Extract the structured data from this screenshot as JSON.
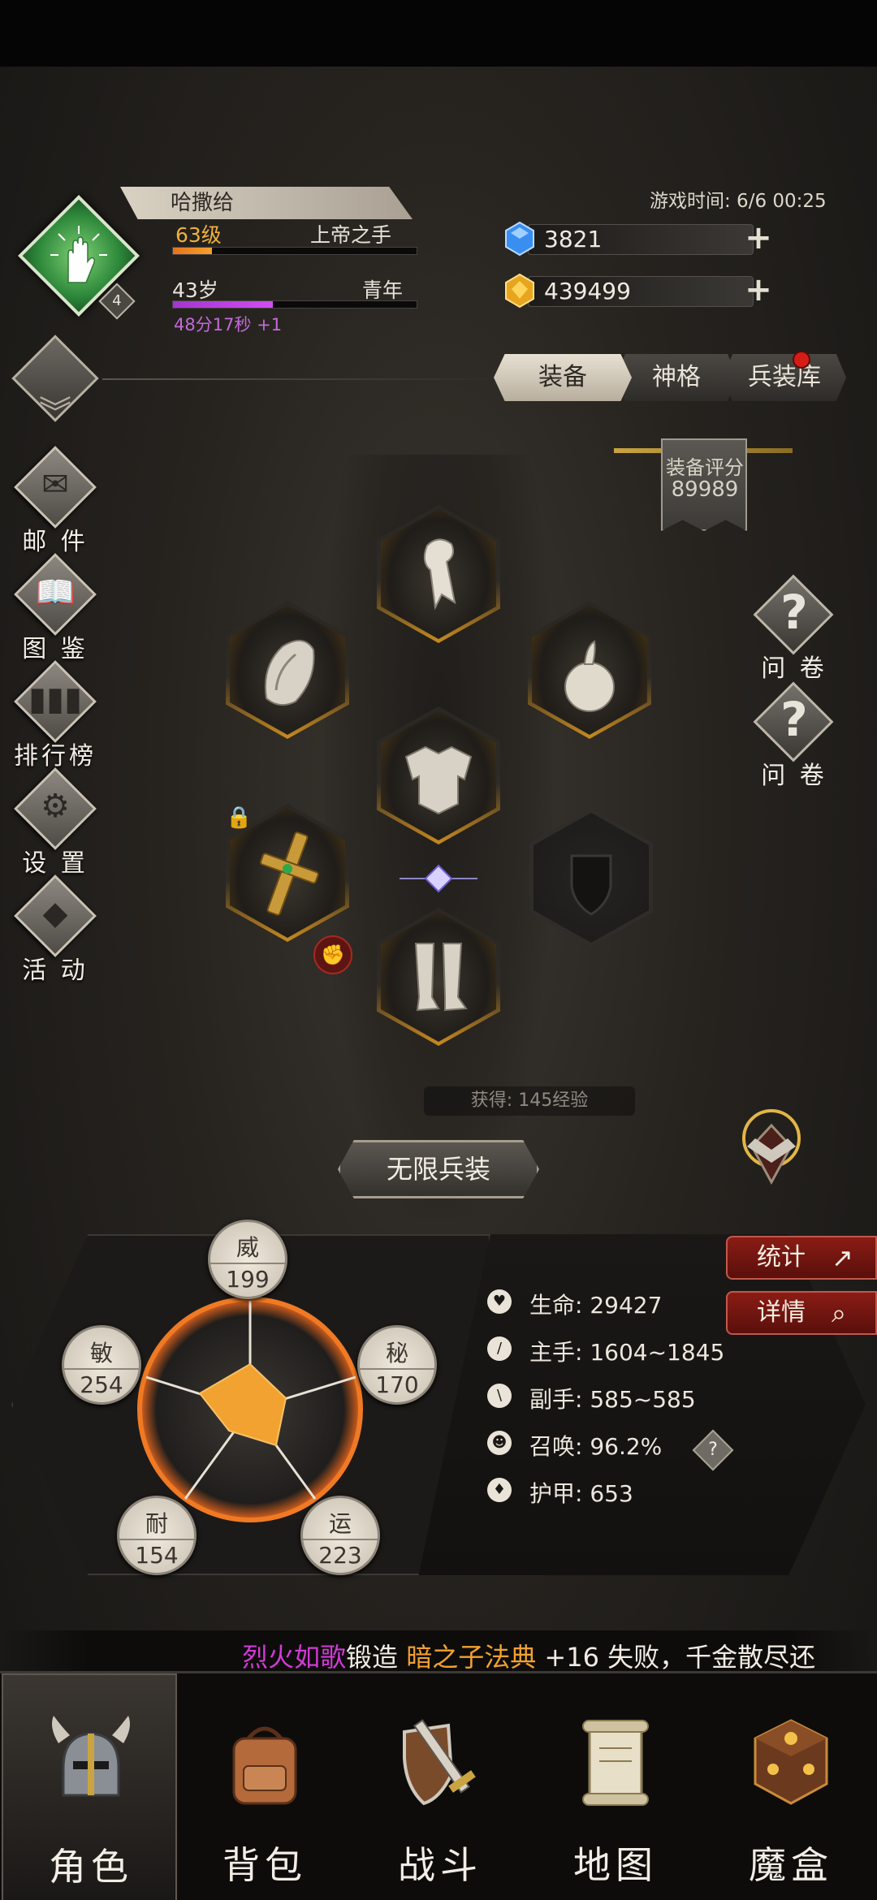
{
  "character": {
    "name": "哈撒给",
    "level": "63级",
    "title": "上帝之手",
    "xp_progress": 0.16,
    "age": "43岁",
    "age_stage": "青年",
    "age_progress": 0.41,
    "age_timer": "48分17秒 +1",
    "avatar_badge": "4"
  },
  "game_time": "游戏时间: 6/6 00:25",
  "currencies": {
    "gems": "3821",
    "gold": "439499"
  },
  "tabs": {
    "equip": "装备",
    "god": "神格",
    "armory": "兵装库"
  },
  "score": {
    "label": "装备评分",
    "value": "89989"
  },
  "left_menu": {
    "mail": "邮 件",
    "codex": "图 鉴",
    "ranking": "排行榜",
    "settings": "设 置",
    "events": "活 动"
  },
  "right_menu": {
    "survey1": "问 卷",
    "survey2": "问 卷",
    "q_glyph": "?"
  },
  "exp_gain": "获得: 145经验",
  "infinite_button": "无限兵装",
  "attributes": {
    "wei": {
      "name": "威",
      "value": "199"
    },
    "mi": {
      "name": "秘",
      "value": "170"
    },
    "yun": {
      "name": "运",
      "value": "223"
    },
    "nai": {
      "name": "耐",
      "value": "154"
    },
    "min": {
      "name": "敏",
      "value": "254"
    }
  },
  "side_buttons": {
    "stats": "统计",
    "details": "详情"
  },
  "stats": {
    "hp": "生命: 29427",
    "main": "主手: 1604~1845",
    "off": "副手: 585~585",
    "summon": "召唤: 96.2%",
    "armor": "护甲: 653"
  },
  "ticker": {
    "player": "烈火如歌",
    "action": "锻造 ",
    "item": "暗之子法典",
    "rest": " +16 失败，千金散尽还"
  },
  "bottom_nav": {
    "role": "角色",
    "bag": "背包",
    "battle": "战斗",
    "map": "地图",
    "box": "魔盒"
  },
  "colors": {
    "accent_gold": "#f3a12f",
    "accent_red": "#8a1c15",
    "age_purple": "#c36ad9",
    "ticker_player": "#d23ad6"
  }
}
